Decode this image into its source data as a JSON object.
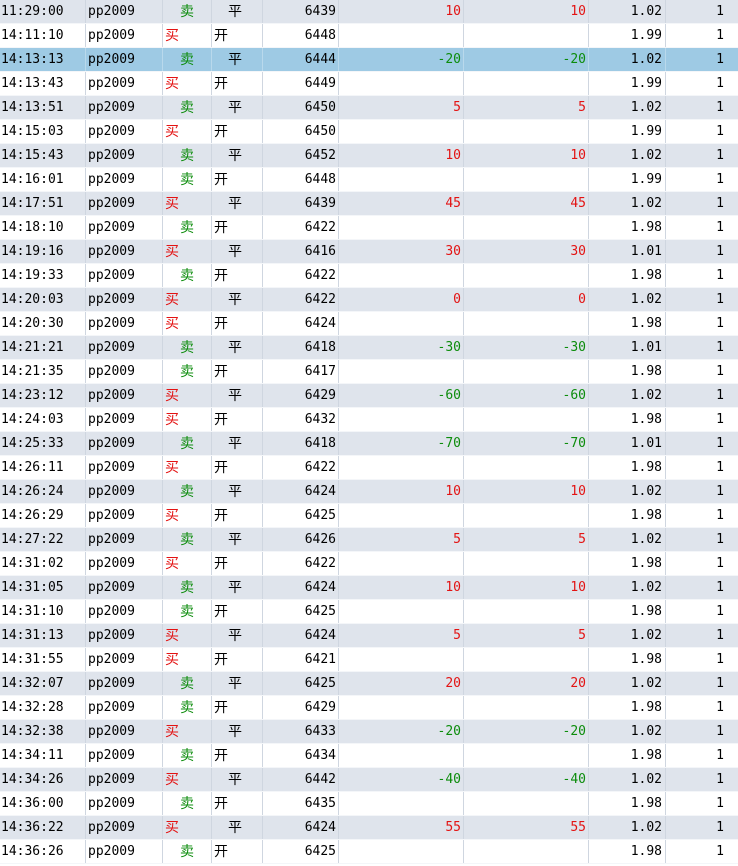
{
  "colors": {
    "profit": "#e31313",
    "loss": "#0c8c0c",
    "selected_row": "#9ecae4",
    "stripe": "#dfe4ec"
  },
  "selected_index": 2,
  "trades": [
    {
      "time": "11:29:00",
      "code": "pp2009",
      "dir": "卖",
      "oc": "平",
      "price": "6439",
      "pl1": "10",
      "pl2": "10",
      "fee": "1.02",
      "qty": "1"
    },
    {
      "time": "14:11:10",
      "code": "pp2009",
      "dir": "买",
      "oc": "开",
      "price": "6448",
      "pl1": "",
      "pl2": "",
      "fee": "1.99",
      "qty": "1"
    },
    {
      "time": "14:13:13",
      "code": "pp2009",
      "dir": "卖",
      "oc": "平",
      "price": "6444",
      "pl1": "-20",
      "pl2": "-20",
      "fee": "1.02",
      "qty": "1"
    },
    {
      "time": "14:13:43",
      "code": "pp2009",
      "dir": "买",
      "oc": "开",
      "price": "6449",
      "pl1": "",
      "pl2": "",
      "fee": "1.99",
      "qty": "1"
    },
    {
      "time": "14:13:51",
      "code": "pp2009",
      "dir": "卖",
      "oc": "平",
      "price": "6450",
      "pl1": "5",
      "pl2": "5",
      "fee": "1.02",
      "qty": "1"
    },
    {
      "time": "14:15:03",
      "code": "pp2009",
      "dir": "买",
      "oc": "开",
      "price": "6450",
      "pl1": "",
      "pl2": "",
      "fee": "1.99",
      "qty": "1"
    },
    {
      "time": "14:15:43",
      "code": "pp2009",
      "dir": "卖",
      "oc": "平",
      "price": "6452",
      "pl1": "10",
      "pl2": "10",
      "fee": "1.02",
      "qty": "1"
    },
    {
      "time": "14:16:01",
      "code": "pp2009",
      "dir": "卖",
      "oc": "开",
      "price": "6448",
      "pl1": "",
      "pl2": "",
      "fee": "1.99",
      "qty": "1"
    },
    {
      "time": "14:17:51",
      "code": "pp2009",
      "dir": "买",
      "oc": "平",
      "price": "6439",
      "pl1": "45",
      "pl2": "45",
      "fee": "1.02",
      "qty": "1"
    },
    {
      "time": "14:18:10",
      "code": "pp2009",
      "dir": "卖",
      "oc": "开",
      "price": "6422",
      "pl1": "",
      "pl2": "",
      "fee": "1.98",
      "qty": "1"
    },
    {
      "time": "14:19:16",
      "code": "pp2009",
      "dir": "买",
      "oc": "平",
      "price": "6416",
      "pl1": "30",
      "pl2": "30",
      "fee": "1.01",
      "qty": "1"
    },
    {
      "time": "14:19:33",
      "code": "pp2009",
      "dir": "卖",
      "oc": "开",
      "price": "6422",
      "pl1": "",
      "pl2": "",
      "fee": "1.98",
      "qty": "1"
    },
    {
      "time": "14:20:03",
      "code": "pp2009",
      "dir": "买",
      "oc": "平",
      "price": "6422",
      "pl1": "0",
      "pl2": "0",
      "fee": "1.02",
      "qty": "1"
    },
    {
      "time": "14:20:30",
      "code": "pp2009",
      "dir": "买",
      "oc": "开",
      "price": "6424",
      "pl1": "",
      "pl2": "",
      "fee": "1.98",
      "qty": "1"
    },
    {
      "time": "14:21:21",
      "code": "pp2009",
      "dir": "卖",
      "oc": "平",
      "price": "6418",
      "pl1": "-30",
      "pl2": "-30",
      "fee": "1.01",
      "qty": "1"
    },
    {
      "time": "14:21:35",
      "code": "pp2009",
      "dir": "卖",
      "oc": "开",
      "price": "6417",
      "pl1": "",
      "pl2": "",
      "fee": "1.98",
      "qty": "1"
    },
    {
      "time": "14:23:12",
      "code": "pp2009",
      "dir": "买",
      "oc": "平",
      "price": "6429",
      "pl1": "-60",
      "pl2": "-60",
      "fee": "1.02",
      "qty": "1"
    },
    {
      "time": "14:24:03",
      "code": "pp2009",
      "dir": "买",
      "oc": "开",
      "price": "6432",
      "pl1": "",
      "pl2": "",
      "fee": "1.98",
      "qty": "1"
    },
    {
      "time": "14:25:33",
      "code": "pp2009",
      "dir": "卖",
      "oc": "平",
      "price": "6418",
      "pl1": "-70",
      "pl2": "-70",
      "fee": "1.01",
      "qty": "1"
    },
    {
      "time": "14:26:11",
      "code": "pp2009",
      "dir": "买",
      "oc": "开",
      "price": "6422",
      "pl1": "",
      "pl2": "",
      "fee": "1.98",
      "qty": "1"
    },
    {
      "time": "14:26:24",
      "code": "pp2009",
      "dir": "卖",
      "oc": "平",
      "price": "6424",
      "pl1": "10",
      "pl2": "10",
      "fee": "1.02",
      "qty": "1"
    },
    {
      "time": "14:26:29",
      "code": "pp2009",
      "dir": "买",
      "oc": "开",
      "price": "6425",
      "pl1": "",
      "pl2": "",
      "fee": "1.98",
      "qty": "1"
    },
    {
      "time": "14:27:22",
      "code": "pp2009",
      "dir": "卖",
      "oc": "平",
      "price": "6426",
      "pl1": "5",
      "pl2": "5",
      "fee": "1.02",
      "qty": "1"
    },
    {
      "time": "14:31:02",
      "code": "pp2009",
      "dir": "买",
      "oc": "开",
      "price": "6422",
      "pl1": "",
      "pl2": "",
      "fee": "1.98",
      "qty": "1"
    },
    {
      "time": "14:31:05",
      "code": "pp2009",
      "dir": "卖",
      "oc": "平",
      "price": "6424",
      "pl1": "10",
      "pl2": "10",
      "fee": "1.02",
      "qty": "1"
    },
    {
      "time": "14:31:10",
      "code": "pp2009",
      "dir": "卖",
      "oc": "开",
      "price": "6425",
      "pl1": "",
      "pl2": "",
      "fee": "1.98",
      "qty": "1"
    },
    {
      "time": "14:31:13",
      "code": "pp2009",
      "dir": "买",
      "oc": "平",
      "price": "6424",
      "pl1": "5",
      "pl2": "5",
      "fee": "1.02",
      "qty": "1"
    },
    {
      "time": "14:31:55",
      "code": "pp2009",
      "dir": "买",
      "oc": "开",
      "price": "6421",
      "pl1": "",
      "pl2": "",
      "fee": "1.98",
      "qty": "1"
    },
    {
      "time": "14:32:07",
      "code": "pp2009",
      "dir": "卖",
      "oc": "平",
      "price": "6425",
      "pl1": "20",
      "pl2": "20",
      "fee": "1.02",
      "qty": "1"
    },
    {
      "time": "14:32:28",
      "code": "pp2009",
      "dir": "卖",
      "oc": "开",
      "price": "6429",
      "pl1": "",
      "pl2": "",
      "fee": "1.98",
      "qty": "1"
    },
    {
      "time": "14:32:38",
      "code": "pp2009",
      "dir": "买",
      "oc": "平",
      "price": "6433",
      "pl1": "-20",
      "pl2": "-20",
      "fee": "1.02",
      "qty": "1"
    },
    {
      "time": "14:34:11",
      "code": "pp2009",
      "dir": "卖",
      "oc": "开",
      "price": "6434",
      "pl1": "",
      "pl2": "",
      "fee": "1.98",
      "qty": "1"
    },
    {
      "time": "14:34:26",
      "code": "pp2009",
      "dir": "买",
      "oc": "平",
      "price": "6442",
      "pl1": "-40",
      "pl2": "-40",
      "fee": "1.02",
      "qty": "1"
    },
    {
      "time": "14:36:00",
      "code": "pp2009",
      "dir": "卖",
      "oc": "开",
      "price": "6435",
      "pl1": "",
      "pl2": "",
      "fee": "1.98",
      "qty": "1"
    },
    {
      "time": "14:36:22",
      "code": "pp2009",
      "dir": "买",
      "oc": "平",
      "price": "6424",
      "pl1": "55",
      "pl2": "55",
      "fee": "1.02",
      "qty": "1"
    },
    {
      "time": "14:36:26",
      "code": "pp2009",
      "dir": "卖",
      "oc": "开",
      "price": "6425",
      "pl1": "",
      "pl2": "",
      "fee": "1.98",
      "qty": "1"
    }
  ]
}
